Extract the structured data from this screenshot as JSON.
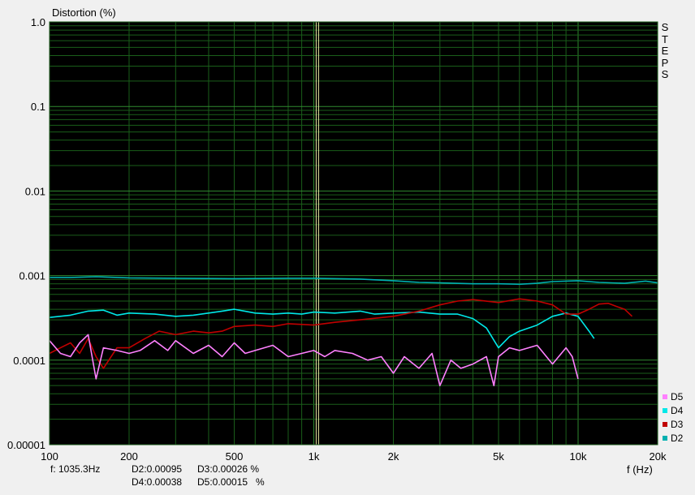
{
  "chart_data": {
    "type": "line",
    "ylabel": "Distortion (%)",
    "xlabel": "f (Hz)",
    "x_scale": "log",
    "y_scale": "log",
    "xlim": [
      100,
      20000
    ],
    "ylim": [
      1e-05,
      1.0
    ],
    "x_ticks": [
      {
        "v": 100,
        "label": "100"
      },
      {
        "v": 200,
        "label": "200"
      },
      {
        "v": 500,
        "label": "500"
      },
      {
        "v": 1000,
        "label": "1k"
      },
      {
        "v": 2000,
        "label": "2k"
      },
      {
        "v": 5000,
        "label": "5k"
      },
      {
        "v": 10000,
        "label": "10k"
      },
      {
        "v": 20000,
        "label": "20k"
      }
    ],
    "y_ticks": [
      {
        "v": 1.0,
        "label": "1.0"
      },
      {
        "v": 0.1,
        "label": "0.1"
      },
      {
        "v": 0.01,
        "label": "0.01"
      },
      {
        "v": 0.001,
        "label": "0.001"
      },
      {
        "v": 0.0001,
        "label": "0.0001"
      },
      {
        "v": 1e-05,
        "label": "0.00001"
      }
    ],
    "grid": true,
    "side_label": "STEPS",
    "cursor_freq": 1035.3,
    "legend_position": "bottom-right",
    "legend": [
      {
        "name": "D5",
        "color": "#ff80ff"
      },
      {
        "name": "D4",
        "color": "#00e8e8"
      },
      {
        "name": "D3",
        "color": "#c00000"
      },
      {
        "name": "D2",
        "color": "#00b0b0"
      }
    ],
    "series": [
      {
        "name": "D2",
        "color": "#00b0b0",
        "points": [
          [
            100,
            0.00095
          ],
          [
            120,
            0.00095
          ],
          [
            150,
            0.00097
          ],
          [
            200,
            0.00094
          ],
          [
            300,
            0.00093
          ],
          [
            500,
            0.00092
          ],
          [
            800,
            0.00093
          ],
          [
            1000,
            0.00093
          ],
          [
            1500,
            0.00091
          ],
          [
            2000,
            0.00087
          ],
          [
            2500,
            0.00083
          ],
          [
            3000,
            0.00082
          ],
          [
            4000,
            0.0008
          ],
          [
            5000,
            0.0008
          ],
          [
            6000,
            0.00079
          ],
          [
            7000,
            0.00081
          ],
          [
            8000,
            0.00085
          ],
          [
            10000,
            0.00087
          ],
          [
            12000,
            0.00083
          ],
          [
            15000,
            0.00081
          ],
          [
            18000,
            0.00086
          ],
          [
            20000,
            0.00082
          ]
        ]
      },
      {
        "name": "D4",
        "color": "#00e8e8",
        "points": [
          [
            100,
            0.00032
          ],
          [
            120,
            0.00034
          ],
          [
            140,
            0.00038
          ],
          [
            160,
            0.00039
          ],
          [
            180,
            0.00034
          ],
          [
            200,
            0.00036
          ],
          [
            250,
            0.00035
          ],
          [
            300,
            0.00033
          ],
          [
            350,
            0.00034
          ],
          [
            400,
            0.00036
          ],
          [
            450,
            0.00038
          ],
          [
            500,
            0.0004
          ],
          [
            600,
            0.00036
          ],
          [
            700,
            0.00035
          ],
          [
            800,
            0.00036
          ],
          [
            900,
            0.00035
          ],
          [
            1000,
            0.00037
          ],
          [
            1200,
            0.00036
          ],
          [
            1500,
            0.00038
          ],
          [
            1700,
            0.00035
          ],
          [
            2000,
            0.00036
          ],
          [
            2500,
            0.00037
          ],
          [
            3000,
            0.00035
          ],
          [
            3500,
            0.00035
          ],
          [
            4000,
            0.00031
          ],
          [
            4500,
            0.00024
          ],
          [
            5000,
            0.00014
          ],
          [
            5500,
            0.00019
          ],
          [
            6000,
            0.00022
          ],
          [
            6500,
            0.00024
          ],
          [
            7000,
            0.00026
          ],
          [
            8000,
            0.00033
          ],
          [
            9000,
            0.00036
          ],
          [
            10000,
            0.00033
          ],
          [
            11000,
            0.00022
          ],
          [
            11500,
            0.00018
          ]
        ]
      },
      {
        "name": "D3",
        "color": "#c00000",
        "points": [
          [
            100,
            0.00012
          ],
          [
            110,
            0.00014
          ],
          [
            120,
            0.00016
          ],
          [
            130,
            0.00012
          ],
          [
            140,
            0.00018
          ],
          [
            150,
            0.00011
          ],
          [
            160,
            8e-05
          ],
          [
            180,
            0.00014
          ],
          [
            200,
            0.00014
          ],
          [
            230,
            0.00018
          ],
          [
            260,
            0.00022
          ],
          [
            300,
            0.0002
          ],
          [
            350,
            0.00022
          ],
          [
            400,
            0.00021
          ],
          [
            450,
            0.00022
          ],
          [
            500,
            0.00025
          ],
          [
            600,
            0.00026
          ],
          [
            700,
            0.00025
          ],
          [
            800,
            0.00027
          ],
          [
            1000,
            0.00026
          ],
          [
            1200,
            0.00028
          ],
          [
            1500,
            0.0003
          ],
          [
            2000,
            0.00033
          ],
          [
            2500,
            0.00038
          ],
          [
            3000,
            0.00045
          ],
          [
            3500,
            0.0005
          ],
          [
            4000,
            0.00052
          ],
          [
            5000,
            0.00048
          ],
          [
            6000,
            0.00053
          ],
          [
            7000,
            0.0005
          ],
          [
            8000,
            0.00045
          ],
          [
            9000,
            0.00035
          ],
          [
            10000,
            0.00035
          ],
          [
            11000,
            0.0004
          ],
          [
            12000,
            0.00046
          ],
          [
            13000,
            0.00047
          ],
          [
            14000,
            0.00043
          ],
          [
            15000,
            0.0004
          ],
          [
            16000,
            0.00033
          ]
        ]
      },
      {
        "name": "D5",
        "color": "#ff80ff",
        "points": [
          [
            100,
            0.00017
          ],
          [
            110,
            0.00012
          ],
          [
            120,
            0.00011
          ],
          [
            130,
            0.00016
          ],
          [
            140,
            0.0002
          ],
          [
            150,
            6e-05
          ],
          [
            160,
            0.00014
          ],
          [
            180,
            0.00013
          ],
          [
            200,
            0.00012
          ],
          [
            220,
            0.00013
          ],
          [
            250,
            0.00017
          ],
          [
            280,
            0.00013
          ],
          [
            300,
            0.00017
          ],
          [
            350,
            0.00012
          ],
          [
            400,
            0.00015
          ],
          [
            450,
            0.00011
          ],
          [
            500,
            0.00016
          ],
          [
            550,
            0.00012
          ],
          [
            600,
            0.00013
          ],
          [
            700,
            0.00015
          ],
          [
            800,
            0.00011
          ],
          [
            900,
            0.00012
          ],
          [
            1000,
            0.00013
          ],
          [
            1100,
            0.00011
          ],
          [
            1200,
            0.00013
          ],
          [
            1400,
            0.00012
          ],
          [
            1600,
            0.0001
          ],
          [
            1800,
            0.00011
          ],
          [
            2000,
            7e-05
          ],
          [
            2200,
            0.00011
          ],
          [
            2500,
            8e-05
          ],
          [
            2800,
            0.00012
          ],
          [
            3000,
            5e-05
          ],
          [
            3300,
            0.0001
          ],
          [
            3600,
            8e-05
          ],
          [
            4000,
            9e-05
          ],
          [
            4500,
            0.00011
          ],
          [
            4800,
            5e-05
          ],
          [
            5000,
            0.00011
          ],
          [
            5500,
            0.00014
          ],
          [
            6000,
            0.00013
          ],
          [
            7000,
            0.00015
          ],
          [
            8000,
            9e-05
          ],
          [
            9000,
            0.00014
          ],
          [
            9500,
            0.00011
          ],
          [
            10000,
            6e-05
          ]
        ]
      }
    ]
  },
  "readout": {
    "f": "f: 1035.3Hz",
    "d2": "D2:0.00095",
    "d3": "D3:0.00026 %",
    "d4": "D4:0.00038",
    "d5": "D5:0.00015   %"
  }
}
